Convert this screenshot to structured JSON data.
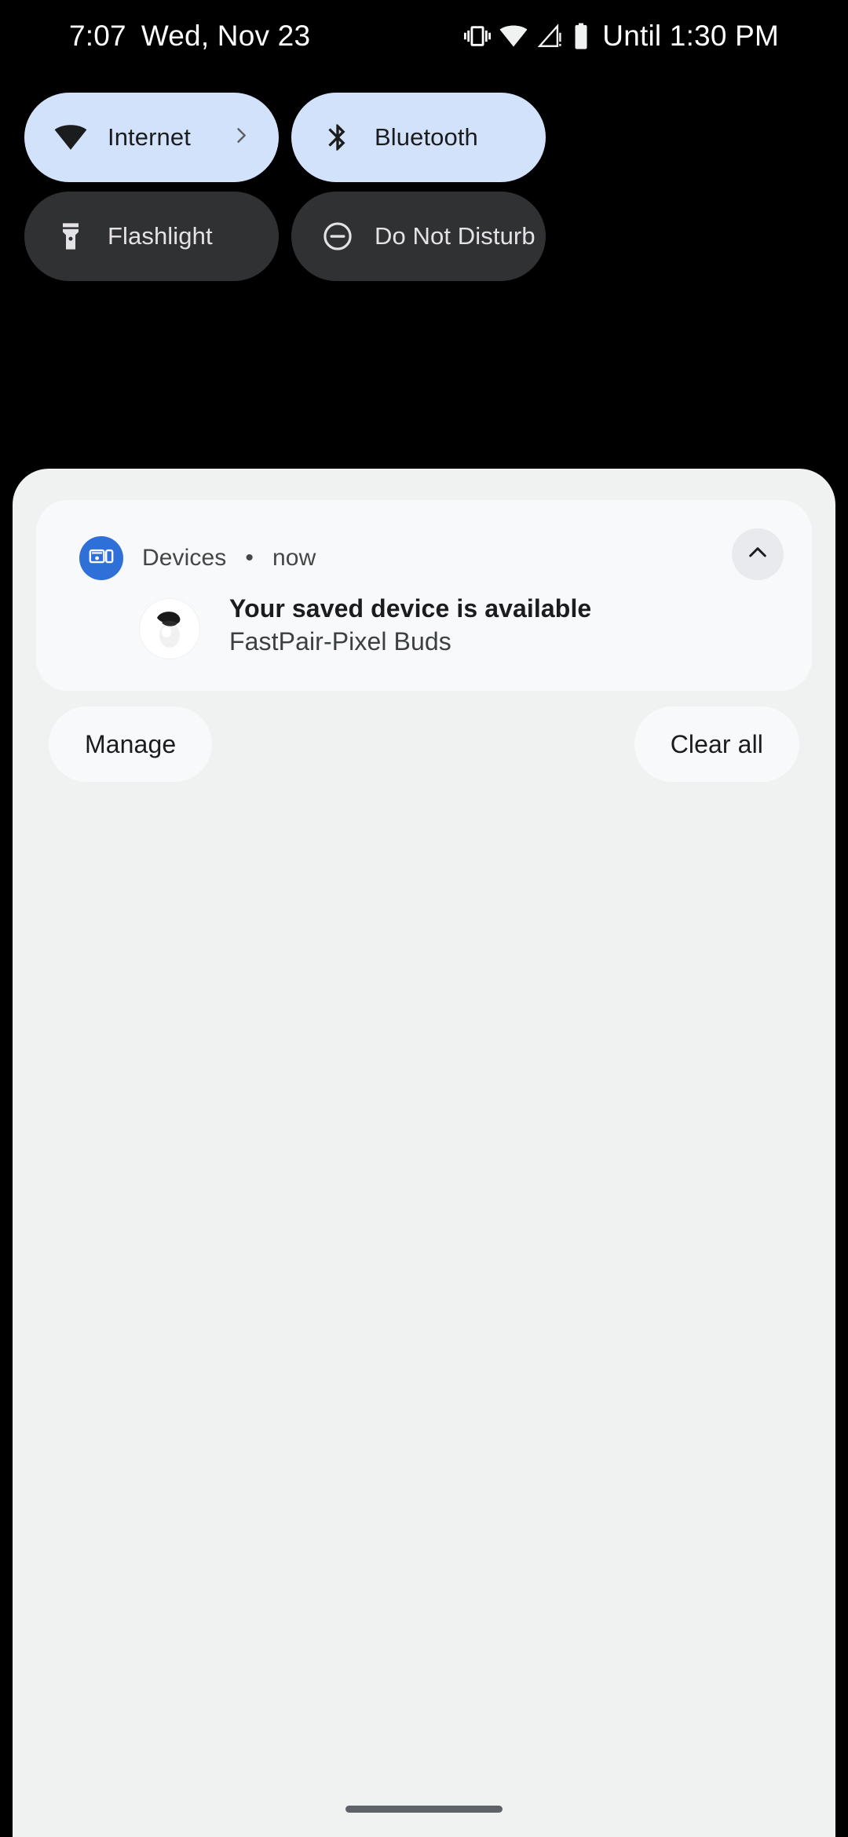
{
  "status_bar": {
    "time": "7:07",
    "date": "Wed, Nov 23",
    "dnd_until": "Until 1:30 PM",
    "icons": [
      {
        "name": "vibrate-icon",
        "label": "Vibrate"
      },
      {
        "name": "wifi-icon",
        "label": "Wi-Fi"
      },
      {
        "name": "no-signal-warning-icon",
        "label": "No signal"
      },
      {
        "name": "battery-icon",
        "label": "Battery"
      }
    ]
  },
  "quick_settings": {
    "tiles": [
      {
        "id": "internet",
        "label": "Internet",
        "icon": "wifi-icon",
        "state": "on",
        "has_chevron": true
      },
      {
        "id": "bluetooth",
        "label": "Bluetooth",
        "icon": "bluetooth-icon",
        "state": "on",
        "has_chevron": false
      },
      {
        "id": "flashlight",
        "label": "Flashlight",
        "icon": "flashlight-icon",
        "state": "off",
        "has_chevron": false
      },
      {
        "id": "dnd",
        "label": "Do Not Disturb",
        "icon": "do-not-disturb-icon",
        "state": "off",
        "has_chevron": false
      }
    ],
    "colors": {
      "tile_on_bg": "#D3E2FB",
      "tile_on_fg": "#1B1C1E",
      "tile_off_bg": "#2F3133",
      "tile_off_fg": "#E4E2E6"
    }
  },
  "shade": {
    "background": "#F0F1F1",
    "notification": {
      "app_name": "Devices",
      "separator": "•",
      "time": "now",
      "title": "Your saved device is available",
      "subtitle": "FastPair-Pixel Buds",
      "app_icon": "devices-icon",
      "app_icon_bg": "#2F70D8",
      "thumbnail": "pixel-buds-earbud-image",
      "collapse_icon": "chevron-up-icon"
    },
    "footer": {
      "manage_label": "Manage",
      "clear_all_label": "Clear all"
    }
  },
  "navigation": {
    "home_handle": "home-gesture-handle"
  }
}
